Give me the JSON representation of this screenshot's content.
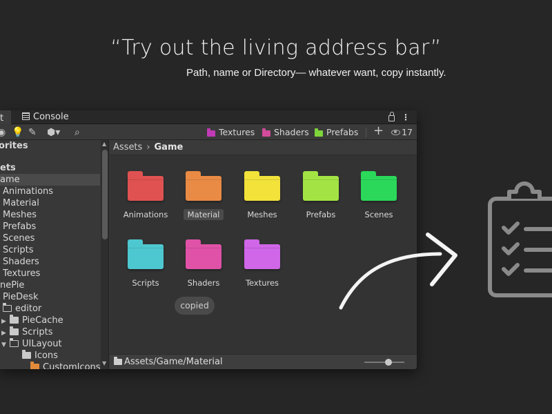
{
  "headline": "“Try out the living address bar”",
  "subline": "Path, name or Directory— whatever want, copy instantly.",
  "window": {
    "tabs": {
      "project_partial": "t",
      "console": "Console"
    },
    "toolbar": {
      "icons": [
        "dot-icon",
        "lightbulb-icon",
        "edit-icon",
        "cube-icon",
        "search-icon"
      ],
      "quick_folders": [
        {
          "label": "Textures",
          "color": "#c13ab5"
        },
        {
          "label": "Shaders",
          "color": "#d14c9b"
        },
        {
          "label": "Prefabs",
          "color": "#7fd63b"
        }
      ],
      "add_symbol": "+",
      "visible_count": "17"
    },
    "tree": {
      "favorites": "orites",
      "assets": "ets",
      "game": "ame",
      "children": [
        "Animations",
        "Material",
        "Meshes",
        "Prefabs",
        "Scenes",
        "Scripts",
        "Shaders",
        "Textures"
      ],
      "nepie": "nePie",
      "piedesk": "PieDesk",
      "editor": "editor",
      "piecache": "PieCache",
      "scripts2": "Scripts",
      "uilayout": "UILayout",
      "icons": "Icons",
      "custom_partial": "Customlcons"
    },
    "breadcrumb": {
      "root": "Assets",
      "current": "Game"
    },
    "folders": [
      {
        "label": "Animations",
        "color": "#e05252"
      },
      {
        "label": "Material",
        "color": "#ea8b45"
      },
      {
        "label": "Meshes",
        "color": "#f2e23a"
      },
      {
        "label": "Prefabs",
        "color": "#a3e444"
      },
      {
        "label": "Scenes",
        "color": "#2bd85a"
      },
      {
        "label": "Scripts",
        "color": "#4ec8d0"
      },
      {
        "label": "Shaders",
        "color": "#e052a8"
      },
      {
        "label": "Textures",
        "color": "#d066e8"
      }
    ],
    "selected_folder": "Material",
    "toast": "copied",
    "status_path": "Assets/Game/Material",
    "zoom_level": 0.6
  },
  "colors": {
    "background": "#262626",
    "panel": "#383838",
    "accent_white": "#f2f2f2"
  }
}
